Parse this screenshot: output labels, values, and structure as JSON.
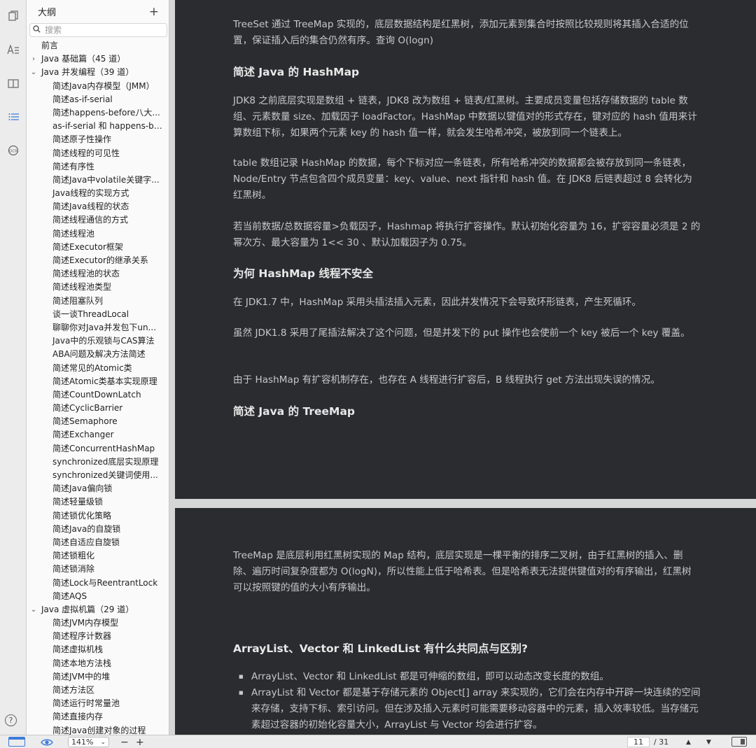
{
  "outline": {
    "title": "大纲",
    "add_icon": "plus-icon",
    "search_placeholder": "搜索",
    "items": [
      {
        "label": "前言",
        "level": 0,
        "caret": ""
      },
      {
        "label": "Java 基础篇（45 道）",
        "level": 0,
        "caret": "›"
      },
      {
        "label": "Java 并发编程（39 道）",
        "level": 0,
        "caret": "⌄"
      },
      {
        "label": "简述Java内存模型（JMM）",
        "level": 1
      },
      {
        "label": "简述as-if-serial",
        "level": 1
      },
      {
        "label": "简述happens-before八大...",
        "level": 1
      },
      {
        "label": "as-if-serial 和 happens-be...",
        "level": 1
      },
      {
        "label": "简述原子性操作",
        "level": 1
      },
      {
        "label": "简述线程的可见性",
        "level": 1
      },
      {
        "label": "简述有序性",
        "level": 1
      },
      {
        "label": "简述Java中volatile关键字...",
        "level": 1
      },
      {
        "label": "Java线程的实现方式",
        "level": 1
      },
      {
        "label": "简述Java线程的状态",
        "level": 1
      },
      {
        "label": "简述线程通信的方式",
        "level": 1
      },
      {
        "label": "简述线程池",
        "level": 1
      },
      {
        "label": "简述Executor框架",
        "level": 1
      },
      {
        "label": "简述Executor的继承关系",
        "level": 1
      },
      {
        "label": "简述线程池的状态",
        "level": 1
      },
      {
        "label": "简述线程池类型",
        "level": 1
      },
      {
        "label": "简述阻塞队列",
        "level": 1
      },
      {
        "label": "谈一谈ThreadLocal",
        "level": 1
      },
      {
        "label": "聊聊你对Java并发包下un...",
        "level": 1
      },
      {
        "label": "Java中的乐观锁与CAS算法",
        "level": 1
      },
      {
        "label": "ABA问题及解决方法简述",
        "level": 1
      },
      {
        "label": "简述常见的Atomic类",
        "level": 1
      },
      {
        "label": "简述Atomic类基本实现原理",
        "level": 1
      },
      {
        "label": "简述CountDownLatch",
        "level": 1
      },
      {
        "label": "简述CyclicBarrier",
        "level": 1
      },
      {
        "label": "简述Semaphore",
        "level": 1
      },
      {
        "label": "简述Exchanger",
        "level": 1
      },
      {
        "label": "简述ConcurrentHashMap",
        "level": 1
      },
      {
        "label": "synchronized底层实现原理",
        "level": 1
      },
      {
        "label": "synchronized关键词使用...",
        "level": 1
      },
      {
        "label": "简述Java偏向锁",
        "level": 1
      },
      {
        "label": "简述轻量级锁",
        "level": 1
      },
      {
        "label": "简述锁优化策略",
        "level": 1
      },
      {
        "label": "简述Java的自旋锁",
        "level": 1
      },
      {
        "label": "简述自适应自旋锁",
        "level": 1
      },
      {
        "label": "简述锁粗化",
        "level": 1
      },
      {
        "label": "简述锁消除",
        "level": 1
      },
      {
        "label": "简述Lock与ReentrantLock",
        "level": 1
      },
      {
        "label": "简述AQS",
        "level": 1
      },
      {
        "label": "Java 虚拟机篇（29 道）",
        "level": 0,
        "caret": "⌄"
      },
      {
        "label": "简述JVM内存模型",
        "level": 1
      },
      {
        "label": "简述程序计数器",
        "level": 1
      },
      {
        "label": "简述虚拟机栈",
        "level": 1
      },
      {
        "label": "简述本地方法栈",
        "level": 1
      },
      {
        "label": "简述JVM中的堆",
        "level": 1
      },
      {
        "label": "简述方法区",
        "level": 1
      },
      {
        "label": "简述运行时常量池",
        "level": 1
      },
      {
        "label": "简述直接内存",
        "level": 1
      },
      {
        "label": "简述Java创建对象的过程",
        "level": 1
      }
    ]
  },
  "rail": {
    "icons": [
      "pages-icon",
      "text-format-icon",
      "book-icon",
      "outline-list-icon",
      "ocr-icon"
    ],
    "help_icon": "help-icon"
  },
  "document": {
    "page1": {
      "p1": "TreeSet 通过 TreeMap 实现的，底层数据结构是红黑树，添加元素到集合时按照比较规则将其插入合适的位置，保证插入后的集合仍然有序。查询 O(logn)",
      "h1": "简述 Java 的 HashMap",
      "p2": "JDK8 之前底层实现是数组 + 链表，JDK8 改为数组 + 链表/红黑树。主要成员变量包括存储数据的 table 数组、元素数量 size、加载因子 loadFactor。HashMap 中数据以键值对的形式存在，键对应的 hash 值用来计算数组下标，如果两个元素 key 的 hash 值一样，就会发生哈希冲突，被放到同一个链表上。",
      "p3": "table 数组记录 HashMap 的数据，每个下标对应一条链表，所有哈希冲突的数据都会被存放到同一条链表，Node/Entry 节点包含四个成员变量：key、value、next 指针和 hash 值。在 JDK8 后链表超过 8 会转化为红黑树。",
      "p4": "若当前数据/总数据容量>负载因子，Hashmap 将执行扩容操作。默认初始化容量为 16，扩容容量必须是 2 的幂次方、最大容量为 1<< 30 、默认加载因子为 0.75。",
      "h2": "为何 HashMap 线程不安全",
      "p5": "在 JDK1.7 中，HashMap 采用头插法插入元素，因此并发情况下会导致环形链表，产生死循环。",
      "p6": "虽然 JDK1.8 采用了尾插法解决了这个问题，但是并发下的 put 操作也会使前一个 key 被后一个 key 覆盖。",
      "p7": "由于 HashMap 有扩容机制存在，也存在 A 线程进行扩容后，B 线程执行 get 方法出现失误的情况。",
      "h3": "简述 Java 的 TreeMap"
    },
    "page2": {
      "p1": "TreeMap 是底层利用红黑树实现的 Map 结构，底层实现是一棵平衡的排序二叉树，由于红黑树的插入、删除、遍历时间复杂度都为 O(logN)，所以性能上低于哈希表。但是哈希表无法提供键值对的有序输出，红黑树可以按照键的值的大小有序输出。",
      "h1": "ArrayList、Vector 和 LinkedList 有什么共同点与区别?",
      "bullets": [
        "ArrayList、Vector 和 LinkedList 都是可伸缩的数组，即可以动态改变长度的数组。",
        "ArrayList 和 Vector 都是基于存储元素的 Object[] array 来实现的，它们会在内存中开辟一块连续的空间来存储，支持下标、索引访问。但在涉及插入元素时可能需要移动容器中的元素，插入效率较低。当存储元素超过容器的初始化容量大小，ArrayList 与 Vector 均会进行扩容。"
      ]
    }
  },
  "bottombar": {
    "zoom": "141%",
    "zoom_out": "−",
    "zoom_in": "+",
    "page_current": "11",
    "page_total": "/ 31",
    "prev": "▲",
    "next": "▼",
    "eye_icon": "eye-icon"
  }
}
